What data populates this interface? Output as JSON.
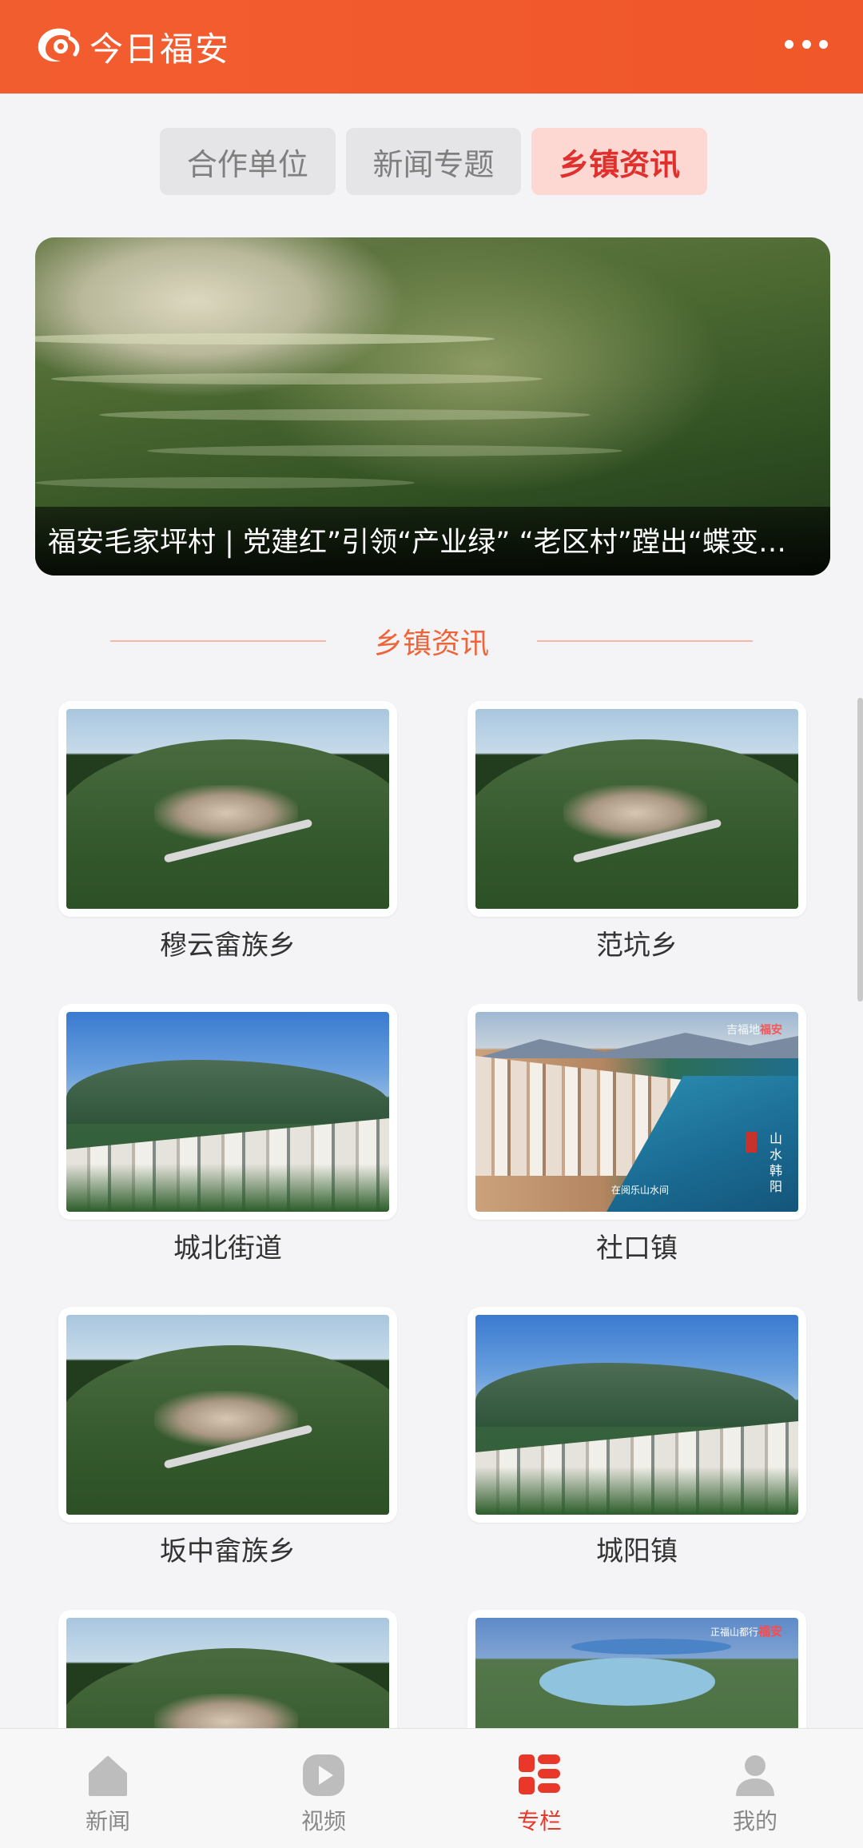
{
  "app": {
    "title": "今日福安"
  },
  "tabs": [
    {
      "label": "合作单位",
      "active": false
    },
    {
      "label": "新闻专题",
      "active": false
    },
    {
      "label": "乡镇资讯",
      "active": true
    }
  ],
  "hero": {
    "caption": "福安毛家坪村 | 党建红”引领“产业绿” “老区村”蹚出“蝶变…"
  },
  "section": {
    "title": "乡镇资讯"
  },
  "items": [
    {
      "label": "穆云畲族乡",
      "image": "mountain-village"
    },
    {
      "label": "范坑乡",
      "image": "mountain-village"
    },
    {
      "label": "城北街道",
      "image": "town-aerial"
    },
    {
      "label": "社口镇",
      "image": "river-town",
      "overlay": {
        "brand_small": "吉福地",
        "brand_red": "福安",
        "caption": "在阅乐山水间",
        "vertical": "山水韩阳"
      }
    },
    {
      "label": "坂中畲族乡",
      "image": "mountain-village"
    },
    {
      "label": "城阳镇",
      "image": "town-aerial"
    },
    {
      "label": "",
      "image": "mountain-village"
    },
    {
      "label": "",
      "image": "park-aerial",
      "overlay": {
        "brand_small": "正福山都行",
        "brand_red": "福安"
      }
    }
  ],
  "bottom_nav": [
    {
      "label": "新闻",
      "icon": "home-icon",
      "active": false
    },
    {
      "label": "视频",
      "icon": "play-icon",
      "active": false
    },
    {
      "label": "专栏",
      "icon": "column-icon",
      "active": true
    },
    {
      "label": "我的",
      "icon": "user-icon",
      "active": false
    }
  ],
  "colors": {
    "accent": "#f05a2c",
    "active_tab_bg": "#fdd7d2",
    "active_tab_text": "#e0302d",
    "nav_active": "#e9382a"
  }
}
